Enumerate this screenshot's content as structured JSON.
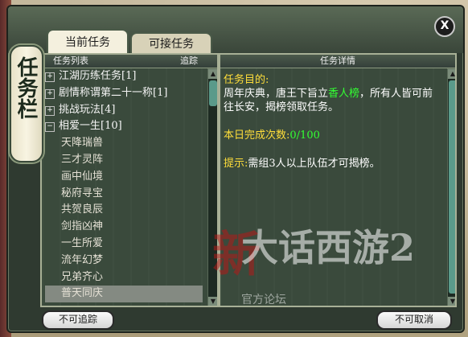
{
  "window": {
    "plaque_title": "任务栏",
    "close_label": "X"
  },
  "tabs": [
    {
      "label": "当前任务"
    },
    {
      "label": "可接任务"
    }
  ],
  "left_panel": {
    "header_title": "任务列表",
    "header_action": "追踪",
    "items": [
      {
        "label": "江湖历练任务[1]",
        "expander": "+"
      },
      {
        "label": "剧情称谓第二十一称[1]",
        "expander": "+"
      },
      {
        "label": "挑战玩法[4]",
        "expander": "+"
      },
      {
        "label": "相爱一生[10]",
        "expander": "−"
      },
      {
        "label": "天降瑞兽"
      },
      {
        "label": "三才灵阵"
      },
      {
        "label": "画中仙境"
      },
      {
        "label": "秘府寻宝"
      },
      {
        "label": "共贺良辰"
      },
      {
        "label": "剑指凶神"
      },
      {
        "label": "一生所爱"
      },
      {
        "label": "流年幻梦"
      },
      {
        "label": "兄弟齐心"
      },
      {
        "label": "普天同庆"
      }
    ]
  },
  "right_panel": {
    "header_title": "任务详情",
    "purpose_label": "任务目的:",
    "desc_a": "周年庆典，唐王下旨立",
    "desc_link": "香人榜",
    "desc_b": "，所有人皆可前往长安，揭榜领取任务。",
    "count_label": "本日完成次数:",
    "count_value": "0/100",
    "hint_label": "提示:",
    "hint_text": "需组3人以上队伍才可揭榜。"
  },
  "buttons": {
    "untrack": "不可追踪",
    "cancel": "不可取消"
  },
  "watermark": {
    "red_char": "新",
    "title": "大话西游2",
    "sub": "官方论坛"
  }
}
